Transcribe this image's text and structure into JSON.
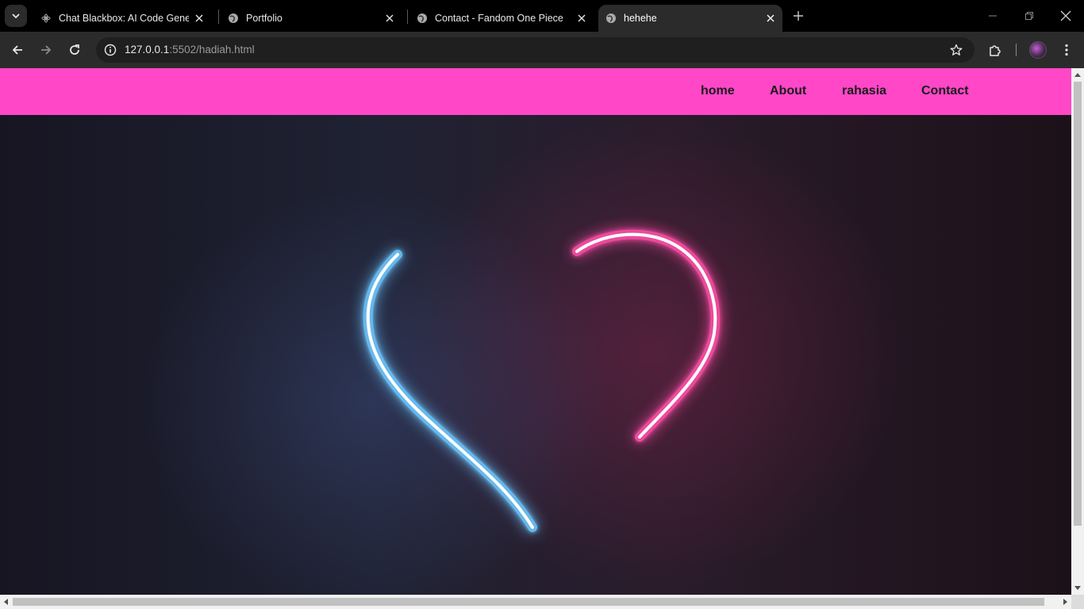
{
  "browser": {
    "tabs": [
      {
        "title": "Chat Blackbox: AI Code Generat",
        "icon": "blackbox-favicon-icon",
        "active": false
      },
      {
        "title": "Portfolio",
        "icon": "globe-icon",
        "active": false
      },
      {
        "title": "Contact - Fandom One Piece",
        "icon": "globe-icon",
        "active": false
      },
      {
        "title": "hehehe",
        "icon": "globe-icon",
        "active": true
      }
    ],
    "url_host": "127.0.0.1",
    "url_path": ":5502/hadiah.html"
  },
  "page": {
    "nav": [
      {
        "label": "home"
      },
      {
        "label": "About"
      },
      {
        "label": "rahasia"
      },
      {
        "label": "Contact"
      }
    ],
    "colors": {
      "navbar": "#ff47c8",
      "neon_blue": "#6ec8ff",
      "neon_pink": "#ff4fa8",
      "hero_bg": "#1f2233"
    },
    "hero_image": "neon broken heart, blue left half and pink right half"
  }
}
